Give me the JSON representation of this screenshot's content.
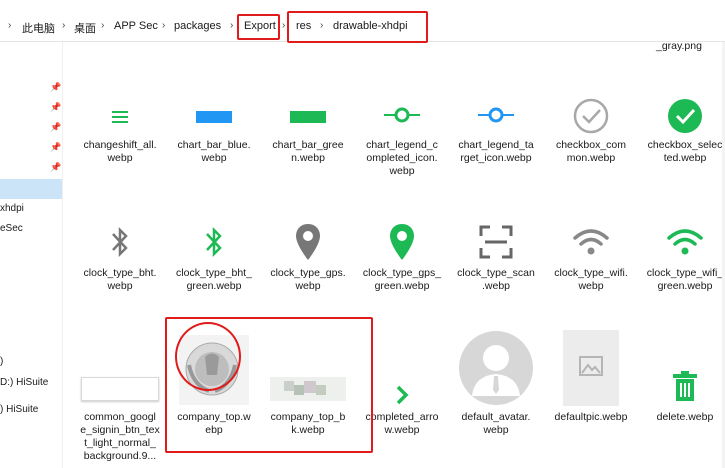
{
  "breadcrumb": [
    "此电脑",
    "桌面",
    "APP Sec",
    "packages",
    "Export",
    "res",
    "drawable-xhdpi"
  ],
  "top_partial_file": "_gray.png",
  "sidebar": {
    "items": [
      "xhdpi",
      "eSec",
      ")",
      "D:) HiSuite",
      ") HiSuite"
    ]
  },
  "files_row1": [
    {
      "name": "changeshift_all.\nwebp",
      "icon": "list-icon"
    },
    {
      "name": "chart_bar_blue.\nwebp",
      "icon": "blue-bar-icon"
    },
    {
      "name": "chart_bar_gree\nn.webp",
      "icon": "green-bar-icon"
    },
    {
      "name": "chart_legend_c\nompleted_icon.\nwebp",
      "icon": "green-legend-icon"
    },
    {
      "name": "chart_legend_ta\nrget_icon.webp",
      "icon": "blue-legend-icon"
    },
    {
      "name": "checkbox_com\nmon.webp",
      "icon": "checkbox-gray-icon"
    },
    {
      "name": "checkbox_selec\nted.webp",
      "icon": "checkbox-green-icon"
    }
  ],
  "files_row2": [
    {
      "name": "clock_type_bht.\nwebp",
      "icon": "bluetooth-gray-icon"
    },
    {
      "name": "clock_type_bht_\ngreen.webp",
      "icon": "bluetooth-green-icon"
    },
    {
      "name": "clock_type_gps.\nwebp",
      "icon": "location-gray-icon"
    },
    {
      "name": "clock_type_gps_\ngreen.webp",
      "icon": "location-green-icon"
    },
    {
      "name": "clock_type_scan\n.webp",
      "icon": "scan-icon"
    },
    {
      "name": "clock_type_wifi.\nwebp",
      "icon": "wifi-gray-icon"
    },
    {
      "name": "clock_type_wifi_\ngreen.webp",
      "icon": "wifi-green-icon"
    }
  ],
  "files_row3": [
    {
      "name": "common_googl\ne_signin_btn_tex\nt_light_normal_\nbackground.9...",
      "icon": "google-btn-thumb"
    },
    {
      "name": "company_top.w\nebp",
      "icon": "company-emblem-thumb"
    },
    {
      "name": "company_top_b\nk.webp",
      "icon": "blurred-thumb"
    },
    {
      "name": "completed_arro\nw.webp",
      "icon": "green-arrow-icon"
    },
    {
      "name": "default_avatar.\nwebp",
      "icon": "avatar-thumb"
    },
    {
      "name": "defaultpic.webp",
      "icon": "picture-thumb"
    },
    {
      "name": "delete.webp",
      "icon": "trash-green-icon"
    }
  ],
  "colors": {
    "highlight_red": "#e01b1b",
    "green": "#1db954",
    "blue": "#2196f3",
    "selection": "#cce4f7"
  }
}
